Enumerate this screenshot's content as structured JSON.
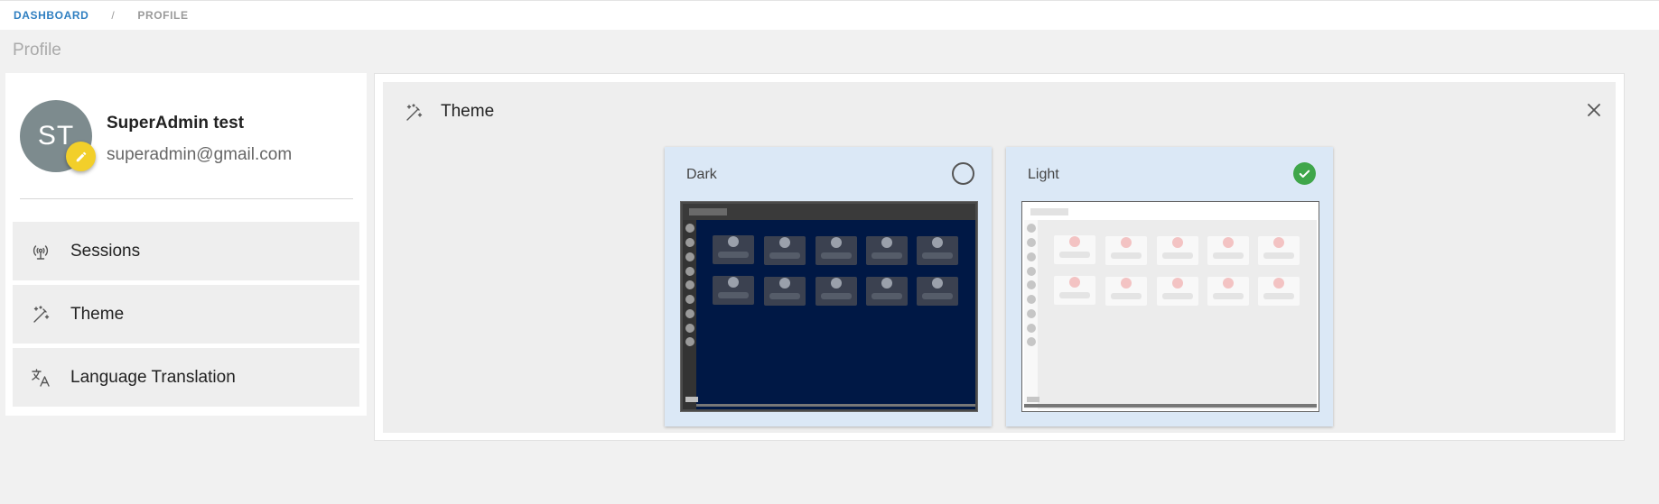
{
  "breadcrumb": {
    "home": "DASHBOARD",
    "separator": "/",
    "current": "PROFILE"
  },
  "page": {
    "title": "Profile"
  },
  "profile": {
    "initials": "ST",
    "name": "SuperAdmin test",
    "email": "superadmin@gmail.com",
    "edit_icon": "pencil-icon"
  },
  "menu": {
    "items": [
      {
        "label": "Sessions",
        "icon": "broadcast-icon"
      },
      {
        "label": "Theme",
        "icon": "magic-wand-icon"
      },
      {
        "label": "Language Translation",
        "icon": "translate-icon"
      }
    ]
  },
  "theme_panel": {
    "title": "Theme",
    "icon": "magic-wand-icon",
    "close_icon": "close-icon",
    "options": [
      {
        "label": "Dark",
        "selected": false
      },
      {
        "label": "Light",
        "selected": true
      }
    ]
  },
  "colors": {
    "accent_link": "#2f7fc1",
    "avatar_bg": "#7d8b8e",
    "edit_badge": "#f2cf2a",
    "card_bg": "#dbe8f6",
    "selected_check": "#3fa64a",
    "dark_preview_bg": "#001845",
    "light_preview_bg": "#ececec"
  }
}
